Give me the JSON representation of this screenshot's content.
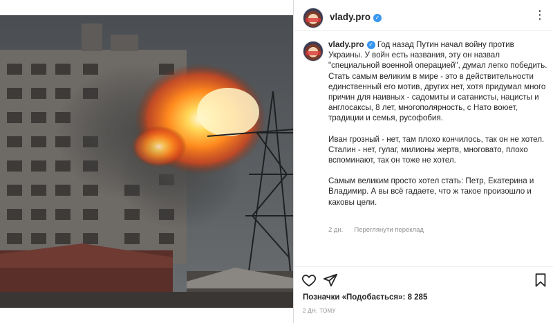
{
  "post": {
    "username": "vlady.pro",
    "caption_paragraph_1": "Год назад Путин начал войну против Украины. У войн есть названия, эту он назвал \"специальной военной операцией\", думал легко победить. Стать самым великим в мире - это в действительности единственный его мотив, других нет, хотя придумал много причин для наивных - садомиты и сатанисты, нацисты и англосаксы, 8 лет, многополярность, с Нато воюет, традиции и семья, русофобия.",
    "caption_paragraph_2": "Иван грозный - нет, там плохо кончилось, так он не хотел. Сталин - нет, гулаг, милионы жертв, многовато, плохо вспоминают, так он тоже не хотел.",
    "caption_paragraph_3": "Самым великим просто хотел стать: Петр, Екатерина и Владимир. А вы всё гадаете, что ж такое произошло и каковы цели.",
    "caption_age": "2 дн.",
    "translate_label": "Переглянути переклад",
    "likes_label": "Позначки «Подобається»:",
    "likes_count": "8 285",
    "post_date": "2 ДН. ТОМУ"
  },
  "icons": {
    "more": "more-icon",
    "like": "heart-icon",
    "share": "share-icon",
    "bookmark": "bookmark-icon",
    "verified": "verified-badge-icon"
  },
  "colors": {
    "verified": "#3897f0",
    "text": "#262626",
    "muted": "#8e8e8e",
    "border": "#dbdbdb"
  }
}
